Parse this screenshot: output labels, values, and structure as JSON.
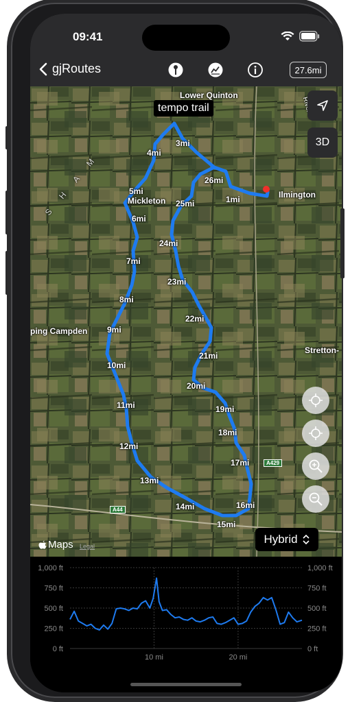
{
  "status": {
    "time": "09:41"
  },
  "nav": {
    "back_label": "gjRoutes",
    "distance_badge": "27.6mi",
    "icons": [
      "pin-icon",
      "elevation-chart-icon",
      "info-icon"
    ]
  },
  "map": {
    "route_title": "tempo trail",
    "place_labels": [
      "Lower Quinton",
      "Mickleton",
      "Ilmington",
      "ping Campden",
      "Stretton-",
      "River S",
      "S H A M"
    ],
    "road_labels": [
      "A429",
      "A44"
    ],
    "mile_markers": [
      "1mi",
      "3mi",
      "4mi",
      "5mi",
      "6mi",
      "7mi",
      "8mi",
      "9mi",
      "10mi",
      "11mi",
      "12mi",
      "13mi",
      "14mi",
      "15mi",
      "16mi",
      "17mi",
      "18mi",
      "19mi",
      "20mi",
      "21mi",
      "22mi",
      "23mi",
      "24mi",
      "25mi",
      "26mi"
    ],
    "buttons": {
      "three_d": "3D",
      "map_type": "Hybrid"
    },
    "attribution": "Maps",
    "legal": "Legal",
    "colors": {
      "route": "#1e7bf0",
      "start_marker": "#f0302a"
    }
  },
  "chart_data": {
    "type": "line",
    "x_ticks": [
      "10 mi",
      "20 mi"
    ],
    "y_ticks_left": [
      "1,000 ft",
      "750 ft",
      "500 ft",
      "250 ft",
      "0 ft"
    ],
    "y_ticks_right": [
      "1,000 ft",
      "750 ft",
      "500 ft",
      "250 ft",
      "0 ft"
    ],
    "ylim": [
      0,
      1000
    ],
    "xlim": [
      0,
      27.6
    ],
    "grid": true,
    "series": [
      {
        "x": [
          0,
          0.5,
          1,
          1.5,
          2,
          2.5,
          3,
          3.5,
          4,
          4.5,
          5,
          5.5,
          6,
          6.5,
          7,
          7.5,
          8,
          8.5,
          9,
          9.5,
          9.9,
          10.3,
          10.6,
          11,
          11.5,
          12,
          12.5,
          13,
          13.5,
          14,
          14.5,
          15,
          15.5,
          16,
          16.5,
          17,
          17.5,
          18,
          18.5,
          19,
          19.5,
          20,
          20.5,
          21,
          21.5,
          22,
          22.5,
          23,
          23.5,
          24,
          24.5,
          25,
          25.5,
          26,
          26.5,
          27,
          27.6
        ],
        "y": [
          360,
          460,
          340,
          310,
          280,
          300,
          250,
          230,
          290,
          240,
          310,
          490,
          500,
          490,
          470,
          500,
          490,
          560,
          590,
          500,
          620,
          870,
          580,
          470,
          480,
          420,
          380,
          390,
          360,
          350,
          380,
          340,
          330,
          350,
          380,
          390,
          310,
          300,
          320,
          350,
          380,
          300,
          310,
          340,
          450,
          520,
          560,
          630,
          600,
          630,
          480,
          300,
          320,
          450,
          380,
          330,
          350
        ],
        "color": "#1e7bf0"
      }
    ]
  }
}
